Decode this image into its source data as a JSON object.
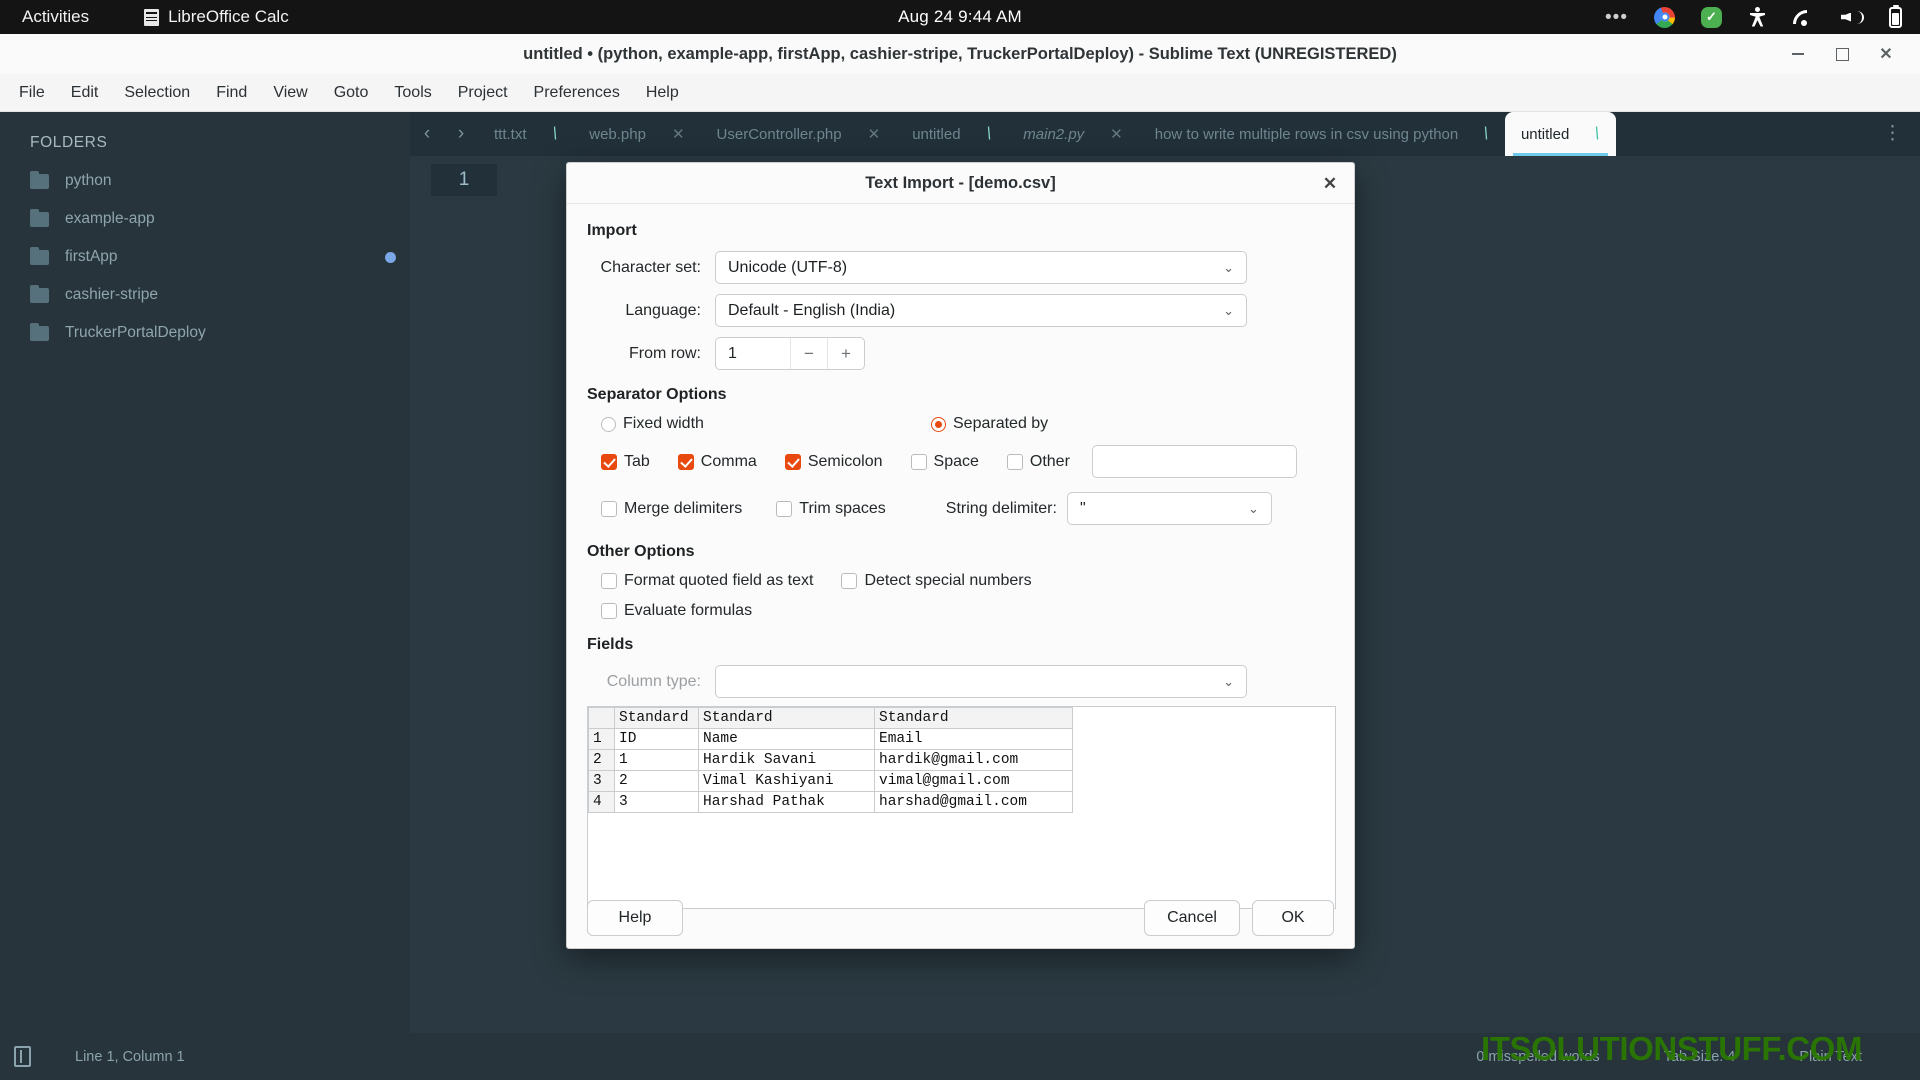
{
  "gnome": {
    "activities": "Activities",
    "app_name": "LibreOffice Calc",
    "clock": "Aug 24  9:44 AM",
    "tray": [
      "tray-overflow",
      "chrome-icon",
      "shield-check-icon",
      "accessibility-icon",
      "wifi-icon",
      "volume-icon",
      "battery-icon"
    ]
  },
  "window": {
    "title": "untitled • (python, example-app, firstApp, cashier-stripe, TruckerPortalDeploy) - Sublime Text (UNREGISTERED)",
    "controls": {
      "minimize": "—",
      "maximize": "▢",
      "close": "✕"
    }
  },
  "menu": [
    "File",
    "Edit",
    "Selection",
    "Find",
    "View",
    "Goto",
    "Tools",
    "Project",
    "Preferences",
    "Help"
  ],
  "sidebar": {
    "header": "FOLDERS",
    "folders": [
      {
        "name": "python",
        "dot": false
      },
      {
        "name": "example-app",
        "dot": false
      },
      {
        "name": "firstApp",
        "dot": true
      },
      {
        "name": "cashier-stripe",
        "dot": false
      },
      {
        "name": "TruckerPortalDeploy",
        "dot": false
      }
    ]
  },
  "tabs": {
    "nav_prev": "‹",
    "nav_next": "›",
    "overflow": "⋮",
    "items": [
      {
        "label": "ttt.txt",
        "state": "dirty",
        "active": false,
        "italic": false
      },
      {
        "label": "web.php",
        "state": "close",
        "active": false,
        "italic": false
      },
      {
        "label": "UserController.php",
        "state": "close",
        "active": false,
        "italic": false
      },
      {
        "label": "untitled",
        "state": "dirty",
        "active": false,
        "italic": false
      },
      {
        "label": "main2.py",
        "state": "close",
        "active": false,
        "italic": true
      },
      {
        "label": "how to write multiple rows in csv using python",
        "state": "dirty",
        "active": false,
        "italic": false
      },
      {
        "label": "untitled",
        "state": "dirty",
        "active": true,
        "italic": false
      }
    ]
  },
  "editor": {
    "line_number": "1"
  },
  "statusbar": {
    "position": "Line 1, Column 1",
    "spelling": "0 misspelled words",
    "tab_size": "Tab Size: 4",
    "syntax": "Plain Text"
  },
  "watermark": "ITSOLUTIONSTUFF.COM",
  "dialog": {
    "title": "Text Import - [demo.csv]",
    "close": "✕",
    "import": {
      "heading": "Import",
      "charset_label": "Character set:",
      "charset_value": "Unicode (UTF-8)",
      "language_label": "Language:",
      "language_value": "Default - English (India)",
      "from_row_label": "From row:",
      "from_row_value": "1",
      "spin_minus": "−",
      "spin_plus": "+"
    },
    "separator": {
      "heading": "Separator Options",
      "fixed_width": {
        "label": "Fixed width",
        "checked": false
      },
      "separated_by": {
        "label": "Separated by",
        "checked": true
      },
      "delimiters": [
        {
          "label": "Tab",
          "checked": true
        },
        {
          "label": "Comma",
          "checked": true
        },
        {
          "label": "Semicolon",
          "checked": true
        },
        {
          "label": "Space",
          "checked": false
        },
        {
          "label": "Other",
          "checked": false
        }
      ],
      "other_value": "",
      "merge_delimiters": {
        "label": "Merge delimiters",
        "checked": false
      },
      "trim_spaces": {
        "label": "Trim spaces",
        "checked": false
      },
      "string_delimiter_label": "String delimiter:",
      "string_delimiter_value": "\""
    },
    "other_options": {
      "heading": "Other Options",
      "format_quoted": {
        "label": "Format quoted field as text",
        "checked": false
      },
      "detect_special": {
        "label": "Detect special numbers",
        "checked": false
      },
      "evaluate_formulas": {
        "label": "Evaluate formulas",
        "checked": false
      }
    },
    "fields": {
      "heading": "Fields",
      "column_type_label": "Column type:",
      "column_type_value": "",
      "column_headers": [
        "Standard",
        "Standard",
        "Standard"
      ],
      "rows": [
        {
          "n": "1",
          "cells": [
            "ID",
            "Name",
            "Email"
          ]
        },
        {
          "n": "2",
          "cells": [
            "1",
            "Hardik Savani",
            "hardik@gmail.com"
          ]
        },
        {
          "n": "3",
          "cells": [
            "2",
            "Vimal Kashiyani",
            "vimal@gmail.com"
          ]
        },
        {
          "n": "4",
          "cells": [
            "3",
            "Harshad Pathak",
            "harshad@gmail.com"
          ]
        }
      ]
    },
    "buttons": {
      "help": "Help",
      "cancel": "Cancel",
      "ok": "OK"
    }
  },
  "colors": {
    "accent_orange": "#e8490e",
    "tab_underline": "#6fc9e8",
    "watermark_green": "#2b7a00"
  }
}
